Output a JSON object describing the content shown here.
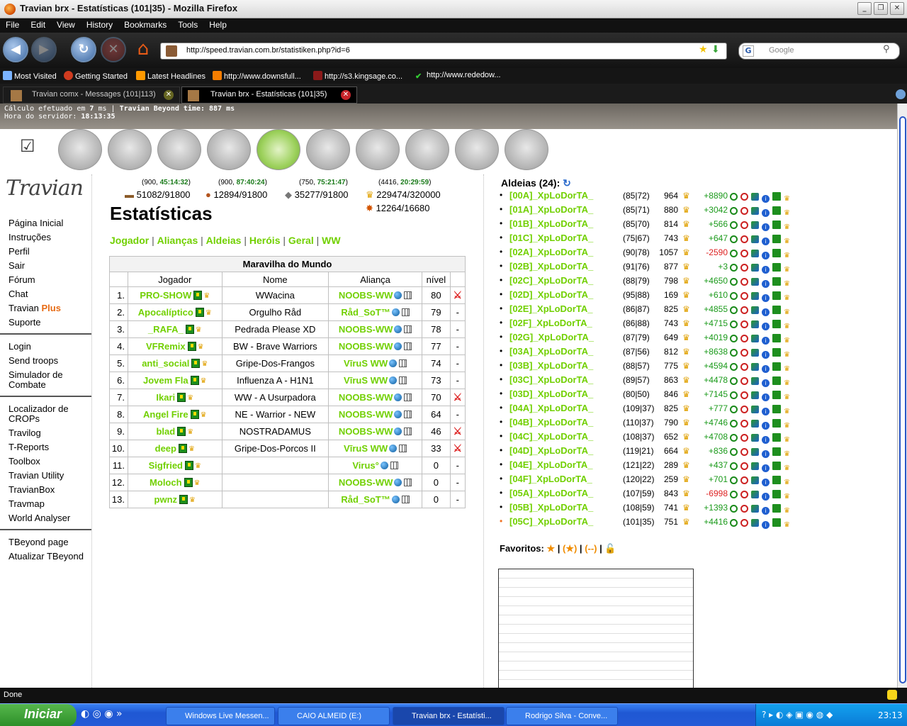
{
  "window": {
    "title": "Travian brx - Estatísticas (101|35) - Mozilla Firefox"
  },
  "menu": [
    "File",
    "Edit",
    "View",
    "History",
    "Bookmarks",
    "Tools",
    "Help"
  ],
  "url": "http://speed.travian.com.br/statistiken.php?id=6",
  "search_placeholder": "Google",
  "bookmarks": [
    "Most Visited",
    "Getting Started",
    "Latest Headlines",
    "http://www.downsfull...",
    "http://s3.kingsage.co...",
    "http://www.rededow..."
  ],
  "tabs": [
    {
      "label": "Travian comx - Messages (101|113)"
    },
    {
      "label": "Travian brx - Estatísticas (101|35)"
    }
  ],
  "info": {
    "line1a": "Cálculo efetuado em ",
    "line1b": "7",
    "line1c": " ms | ",
    "line1d": "Travian Beyond time: 887 ms",
    "line2a": "Hora do servidor: ",
    "line2b": "18:13:35"
  },
  "resources": {
    "timers": [
      {
        "a": "(900, ",
        "b": "45:14:32",
        "c": ")"
      },
      {
        "a": "(900, ",
        "b": "87:40:24",
        "c": ")"
      },
      {
        "a": "(750, ",
        "b": "75:21:47",
        "c": ")"
      },
      {
        "a": "(4416, ",
        "b": "20:29:59",
        "c": ")"
      }
    ],
    "values": [
      "51082/91800",
      "12894/91800",
      "35277/91800",
      "229474/320000",
      "12264/16680"
    ]
  },
  "leftnav": {
    "g1": [
      "Página Inicial",
      "Instruções",
      "Perfil",
      "Sair",
      "Fórum",
      "Chat"
    ],
    "plus_a": "Travian ",
    "plus_b": "Plus",
    "suporte": "Suporte",
    "g2": [
      "Login",
      "Send troops"
    ],
    "sim": "Simulador de",
    "sim2": "Combate",
    "g3a": "Localizador de",
    "g3b": "CROPs",
    "g3": [
      "Travilog",
      "T-Reports",
      "Toolbox",
      "Travian Utility",
      "TravianBox",
      "Travmap",
      "World Analyser"
    ],
    "g4": [
      "TBeyond page",
      "Atualizar TBeyond"
    ]
  },
  "page_title": "Estatísticas",
  "submenu": [
    "Jogador",
    "Alianças",
    "Aldeias",
    "Heróis",
    "Geral",
    "WW"
  ],
  "ww": {
    "caption": "Maravilha do Mundo",
    "headers": [
      "Jogador",
      "Nome",
      "Aliança",
      "nível"
    ],
    "rows": [
      {
        "n": "1.",
        "player": "PRO-SHOW",
        "name": "WWacina",
        "ally": "NOOBS-WW",
        "lvl": "80",
        "x": "sword"
      },
      {
        "n": "2.",
        "player": "Apocalíptico",
        "name": "Orgulho Råd",
        "ally": "Råd_SoT™",
        "lvl": "79",
        "x": "-"
      },
      {
        "n": "3.",
        "player": "_RAFA_",
        "name": "Pedrada Please XD",
        "ally": "NOOBS-WW",
        "lvl": "78",
        "x": "-"
      },
      {
        "n": "4.",
        "player": "VFRemix",
        "name": "BW - Brave Warriors",
        "ally": "NOOBS-WW",
        "lvl": "77",
        "x": "-"
      },
      {
        "n": "5.",
        "player": "anti_social",
        "name": "Gripe-Dos-Frangos",
        "ally": "VīruS WW",
        "lvl": "74",
        "x": "-"
      },
      {
        "n": "6.",
        "player": "Jovem Fla",
        "name": "Influenza A - H1N1",
        "ally": "VīruS WW",
        "lvl": "73",
        "x": "-"
      },
      {
        "n": "7.",
        "player": "Ikari",
        "name": "WW - A Usurpadora",
        "ally": "NOOBS-WW",
        "lvl": "70",
        "x": "sword"
      },
      {
        "n": "8.",
        "player": "Angel Fire",
        "name": "NE - Warrior - NEW",
        "ally": "NOOBS-WW",
        "lvl": "64",
        "x": "-"
      },
      {
        "n": "9.",
        "player": "blad",
        "name": "NOSTRADAMUS",
        "ally": "NOOBS-WW",
        "lvl": "46",
        "x": "sword"
      },
      {
        "n": "10.",
        "player": "deep",
        "name": "Gripe-Dos-Porcos II",
        "ally": "VīruS WW",
        "lvl": "33",
        "x": "sword"
      },
      {
        "n": "11.",
        "player": "Sigfried",
        "name": "",
        "ally": "Virus°",
        "lvl": "0",
        "x": "-"
      },
      {
        "n": "12.",
        "player": "Moloch",
        "name": "",
        "ally": "NOOBS-WW",
        "lvl": "0",
        "x": "-"
      },
      {
        "n": "13.",
        "player": "pwnz",
        "name": "",
        "ally": "Råd_SoT™",
        "lvl": "0",
        "x": "-"
      }
    ]
  },
  "villages_header": "Aldeias (24):",
  "villages": [
    {
      "n": "[00A]_XpLoDorTA_",
      "c": "(85|72)",
      "p": "964",
      "d": "+8890"
    },
    {
      "n": "[01A]_XpLoDorTA_",
      "c": "(85|71)",
      "p": "880",
      "d": "+3042"
    },
    {
      "n": "[01B]_XpLoDorTA_",
      "c": "(85|70)",
      "p": "814",
      "d": "+566"
    },
    {
      "n": "[01C]_XpLoDorTA_",
      "c": "(75|67)",
      "p": "743",
      "d": "+647"
    },
    {
      "n": "[02A]_XpLoDorTA_",
      "c": "(90|78)",
      "p": "1057",
      "d": "-2590"
    },
    {
      "n": "[02B]_XpLoDorTA_",
      "c": "(91|76)",
      "p": "877",
      "d": "+3"
    },
    {
      "n": "[02C]_XpLoDorTA_",
      "c": "(88|79)",
      "p": "798",
      "d": "+4650"
    },
    {
      "n": "[02D]_XpLoDorTA_",
      "c": "(95|88)",
      "p": "169",
      "d": "+610"
    },
    {
      "n": "[02E]_XpLoDorTA_",
      "c": "(86|87)",
      "p": "825",
      "d": "+4855"
    },
    {
      "n": "[02F]_XpLoDorTA_",
      "c": "(86|88)",
      "p": "743",
      "d": "+4715"
    },
    {
      "n": "[02G]_XpLoDorTA_",
      "c": "(87|79)",
      "p": "649",
      "d": "+4019"
    },
    {
      "n": "[03A]_XpLoDorTA_",
      "c": "(87|56)",
      "p": "812",
      "d": "+8638"
    },
    {
      "n": "[03B]_XpLoDorTA_",
      "c": "(88|57)",
      "p": "775",
      "d": "+4594"
    },
    {
      "n": "[03C]_XpLoDorTA_",
      "c": "(89|57)",
      "p": "863",
      "d": "+4478"
    },
    {
      "n": "[03D]_XpLoDorTA_",
      "c": "(80|50)",
      "p": "846",
      "d": "+7145"
    },
    {
      "n": "[04A]_XpLoDorTA_",
      "c": "(109|37)",
      "p": "825",
      "d": "+777"
    },
    {
      "n": "[04B]_XpLoDorTA_",
      "c": "(110|37)",
      "p": "790",
      "d": "+4746"
    },
    {
      "n": "[04C]_XpLoDorTA_",
      "c": "(108|37)",
      "p": "652",
      "d": "+4708"
    },
    {
      "n": "[04D]_XpLoDorTA_",
      "c": "(119|21)",
      "p": "664",
      "d": "+836"
    },
    {
      "n": "[04E]_XpLoDorTA_",
      "c": "(121|22)",
      "p": "289",
      "d": "+437"
    },
    {
      "n": "[04F]_XpLoDorTA_",
      "c": "(120|22)",
      "p": "259",
      "d": "+701"
    },
    {
      "n": "[05A]_XpLoDorTA_",
      "c": "(107|59)",
      "p": "843",
      "d": "-6998"
    },
    {
      "n": "[05B]_XpLoDorTA_",
      "c": "(108|59)",
      "p": "741",
      "d": "+1393"
    },
    {
      "n": "[05C]_XpLoDorTA_",
      "c": "(101|35)",
      "p": "751",
      "d": "+4416"
    }
  ],
  "favoritos": "Favoritos:",
  "status": "Done",
  "taskbar": {
    "start": "Iniciar",
    "items": [
      "Windows Live Messen...",
      "CAIO ALMEID (E:)",
      "Travian brx - Estatísti...",
      "Rodrigo Silva - Conve..."
    ],
    "clock": "23:13"
  }
}
